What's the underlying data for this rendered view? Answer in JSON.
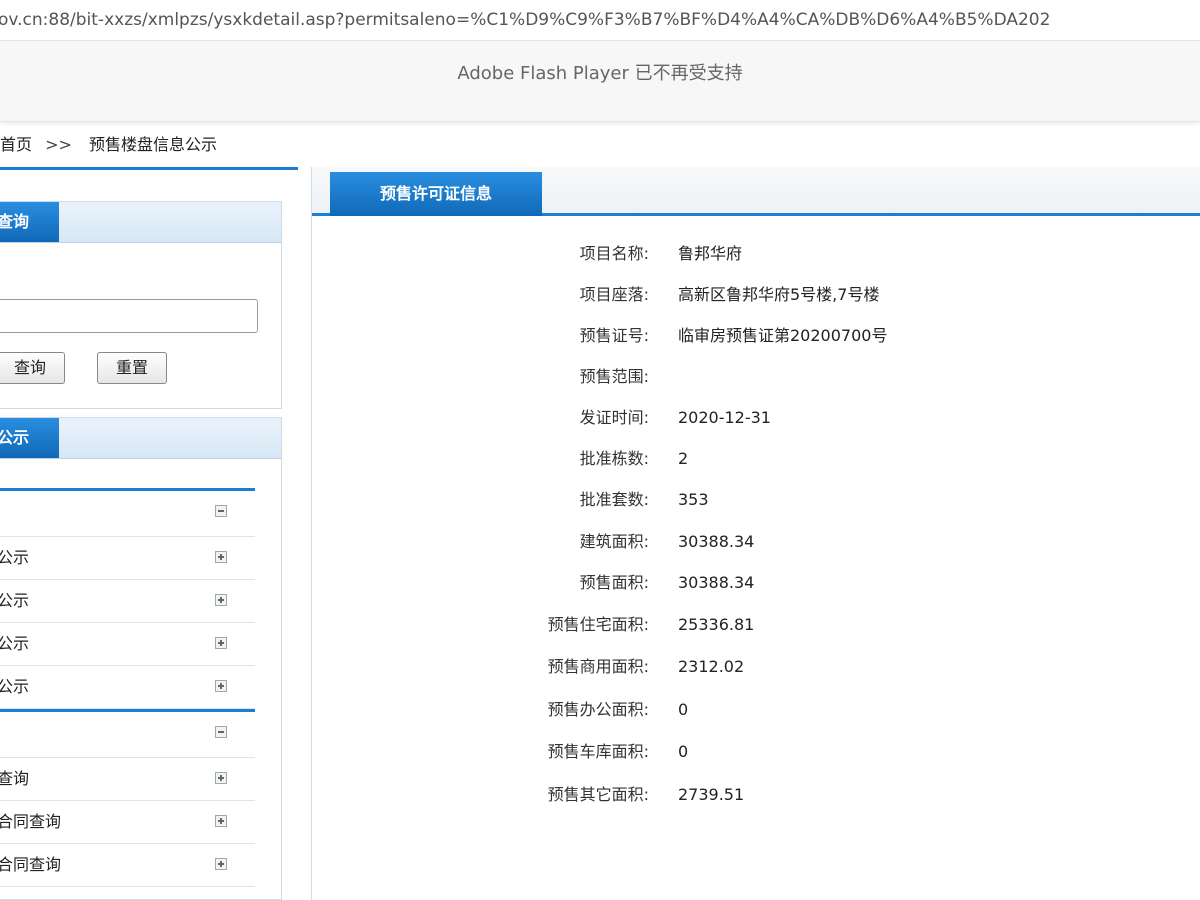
{
  "browser": {
    "url": "ov.cn:88/bit-xxzs/xmlpzs/ysxkdetail.asp?permitsaleno=%C1%D9%C9%F3%B7%BF%D4%A4%CA%DB%D6%A4%B5%DA202"
  },
  "flash_notice": "Adobe Flash Player 已不再受支持",
  "breadcrumb": {
    "home": "首页",
    "separator": ">>",
    "current": "预售楼盘信息公示"
  },
  "left": {
    "search_panel": {
      "title": "查询",
      "input_value": "",
      "query_button": "查询",
      "reset_button": "重置"
    },
    "nav_panel": {
      "title": "公示",
      "groups": [
        {
          "header": "",
          "expanded": true,
          "items": [
            "公示",
            "公示",
            "公示",
            "公示"
          ]
        },
        {
          "header": "",
          "expanded": true,
          "items": [
            "查询",
            "合同查询",
            "合同查询"
          ]
        }
      ]
    }
  },
  "main": {
    "tab_title": "预售许可证信息",
    "fields": [
      {
        "label": "项目名称:",
        "value": "鲁邦华府"
      },
      {
        "label": "项目座落:",
        "value": "高新区鲁邦华府5号楼,7号楼"
      },
      {
        "label": "预售证号:",
        "value": "临审房预售证第20200700号"
      },
      {
        "label": "预售范围:",
        "value": ""
      },
      {
        "label": "发证时间:",
        "value": "2020-12-31"
      },
      {
        "label": "批准栋数:",
        "value": "2"
      },
      {
        "label": "批准套数:",
        "value": "353"
      },
      {
        "label": "建筑面积:",
        "value": "30388.34"
      },
      {
        "label": "预售面积:",
        "value": "30388.34"
      },
      {
        "label": "预售住宅面积:",
        "value": "25336.81"
      },
      {
        "label": "预售商用面积:",
        "value": "2312.02"
      },
      {
        "label": "预售办公面积:",
        "value": "0"
      },
      {
        "label": "预售车库面积:",
        "value": "0"
      },
      {
        "label": "预售其它面积:",
        "value": "2739.51"
      }
    ]
  },
  "colors": {
    "accent": "#1a7fd4",
    "tab_top": "#2a8ee0",
    "tab_bottom": "#1069b8"
  }
}
